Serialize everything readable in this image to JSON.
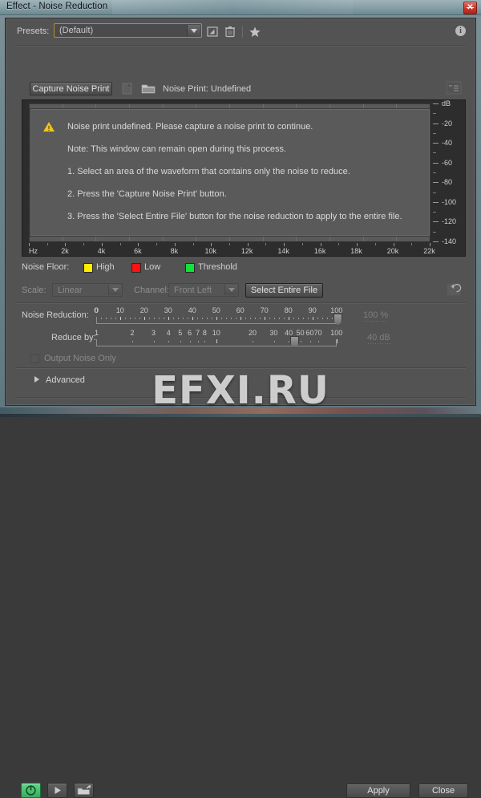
{
  "window": {
    "title": "Effect - Noise Reduction",
    "close_label": "x",
    "close_icon": "close-icon"
  },
  "presets": {
    "label": "Presets:",
    "value": "(Default)",
    "options": [
      "(Default)"
    ],
    "icons": [
      {
        "name": "save-preset-icon",
        "title": "Save preset"
      },
      {
        "name": "delete-preset-icon",
        "title": "Delete preset"
      },
      {
        "name": "favorite-star-icon",
        "title": "Favorite"
      }
    ],
    "info_label": "i",
    "info_icon": "info-icon"
  },
  "noise_print": {
    "capture_button": "Capture Noise Print",
    "save_icon": "save-noise-print-icon",
    "open_icon": "open-noise-print-icon",
    "status": "Noise Print: Undefined",
    "panel_menu_icon": "panel-menu-icon"
  },
  "spectrum": {
    "db_axis_label": "dB",
    "db_ticks": [
      "dB",
      "-20",
      "-40",
      "-60",
      "-80",
      "-100",
      "-120",
      "-140"
    ],
    "hz_axis_label": "Hz",
    "hz_ticks": [
      "Hz",
      "2k",
      "4k",
      "6k",
      "8k",
      "10k",
      "12k",
      "14k",
      "16k",
      "18k",
      "20k",
      "22k"
    ]
  },
  "message": {
    "warning_icon": "warning-triangle-icon",
    "lines": [
      "Noise print undefined. Please capture a noise print to continue.",
      "Note: This window can remain open during this process.",
      "1. Select an area of the waveform that contains only the noise to reduce.",
      "2. Press the 'Capture Noise Print' button.",
      "3. Press the 'Select Entire File' button for the noise reduction to apply to the entire file."
    ]
  },
  "noise_floor": {
    "label": "Noise Floor:",
    "items": [
      {
        "label": "High",
        "color": "#ffee00"
      },
      {
        "label": "Low",
        "color": "#ff1212"
      },
      {
        "label": "Threshold",
        "color": "#12e23a"
      }
    ]
  },
  "scale_row": {
    "scale_label": "Scale:",
    "scale_value": "Linear",
    "channel_label": "Channel:",
    "channel_value": "Front Left",
    "select_entire_file": "Select Entire File",
    "reset_icon": "reset-icon"
  },
  "noise_reduction": {
    "label": "Noise Reduction:",
    "ticks": [
      "0",
      "0",
      "10",
      "20",
      "30",
      "40",
      "50",
      "60",
      "70",
      "80",
      "90",
      "100"
    ],
    "value": "100 %",
    "position_pct": 100
  },
  "reduce_by": {
    "label": "Reduce by:",
    "ticks": [
      "1",
      "2",
      "3",
      "4",
      "5",
      "6",
      "7",
      "8",
      "10",
      "20",
      "30",
      "40",
      "50",
      "60",
      "70",
      "100"
    ],
    "value": "40 dB",
    "position_pct": 76
  },
  "output_noise_only": {
    "label": "Output Noise Only",
    "checked": false
  },
  "advanced": {
    "label": "Advanced",
    "expanded": false,
    "disclosure_icon": "chevron-right-icon"
  },
  "footer": {
    "power_icon": "power-icon",
    "play_icon": "play-icon",
    "export_icon": "export-icon",
    "apply": "Apply",
    "close": "Close"
  },
  "watermark": {
    "text": "EFXI.RU"
  }
}
